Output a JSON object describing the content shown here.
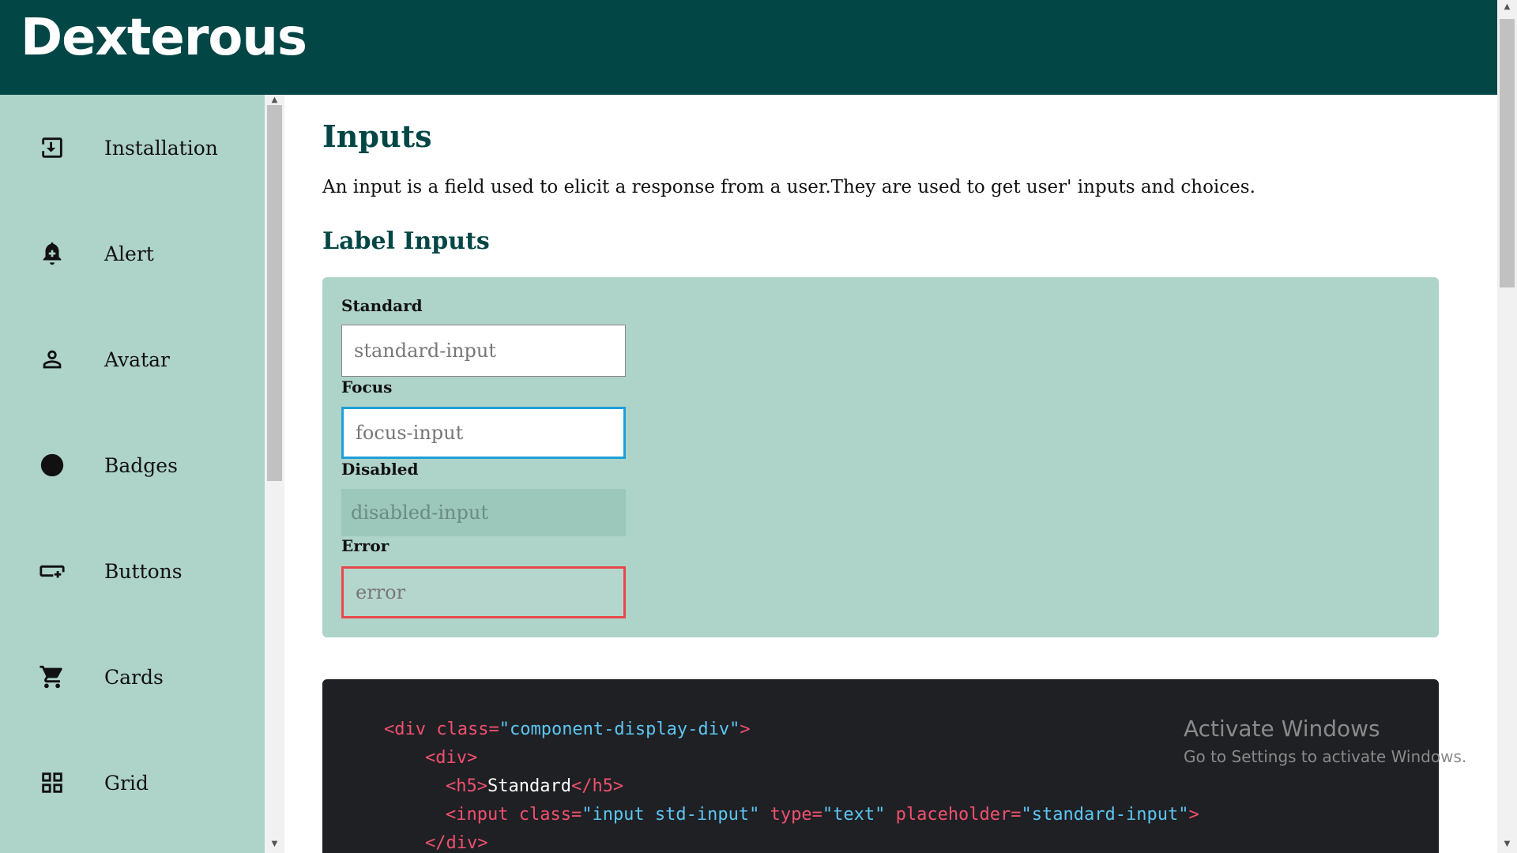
{
  "app": {
    "brand": "Dexterous"
  },
  "sidebar": {
    "items": [
      {
        "label": "Installation",
        "icon": "download-icon"
      },
      {
        "label": "Alert",
        "icon": "bell-add-icon"
      },
      {
        "label": "Avatar",
        "icon": "person-icon"
      },
      {
        "label": "Badges",
        "icon": "circle-icon"
      },
      {
        "label": "Buttons",
        "icon": "button-icon"
      },
      {
        "label": "Cards",
        "icon": "cart-icon"
      },
      {
        "label": "Grid",
        "icon": "grid-icon"
      }
    ]
  },
  "main": {
    "title": "Inputs",
    "description": "An input is a field used to elicit a response from a user.They are used to get user' inputs and choices.",
    "section_title": "Label Inputs",
    "fields": {
      "standard": {
        "label": "Standard",
        "placeholder": "standard-input"
      },
      "focus": {
        "label": "Focus",
        "placeholder": "focus-input"
      },
      "disabled": {
        "label": "Disabled",
        "placeholder": "disabled-input"
      },
      "error": {
        "label": "Error",
        "placeholder": "error"
      }
    },
    "code": {
      "line1_open": "<div ",
      "line1_attr": "class=",
      "line1_val": "\"component-display-div\"",
      "line1_close": ">",
      "line2": "<div>",
      "line3_open": "<h5>",
      "line3_text": "Standard",
      "line3_close": "</h5>",
      "line4_open": "<input ",
      "line4_attr1": "class=",
      "line4_val1": "\"input std-input\"",
      "line4_attr2": " type=",
      "line4_val2": "\"text\"",
      "line4_attr3": " placeholder=",
      "line4_val3": "\"standard-input\"",
      "line4_close": ">",
      "line5": "</div>"
    }
  },
  "watermark": {
    "title": "Activate Windows",
    "subtitle": "Go to Settings to activate Windows."
  },
  "colors": {
    "header": "#024645",
    "sidebar": "#aed3c9",
    "focus_border": "#1e9fd8",
    "error_border": "#e8484a",
    "code_bg": "#1f2024"
  }
}
